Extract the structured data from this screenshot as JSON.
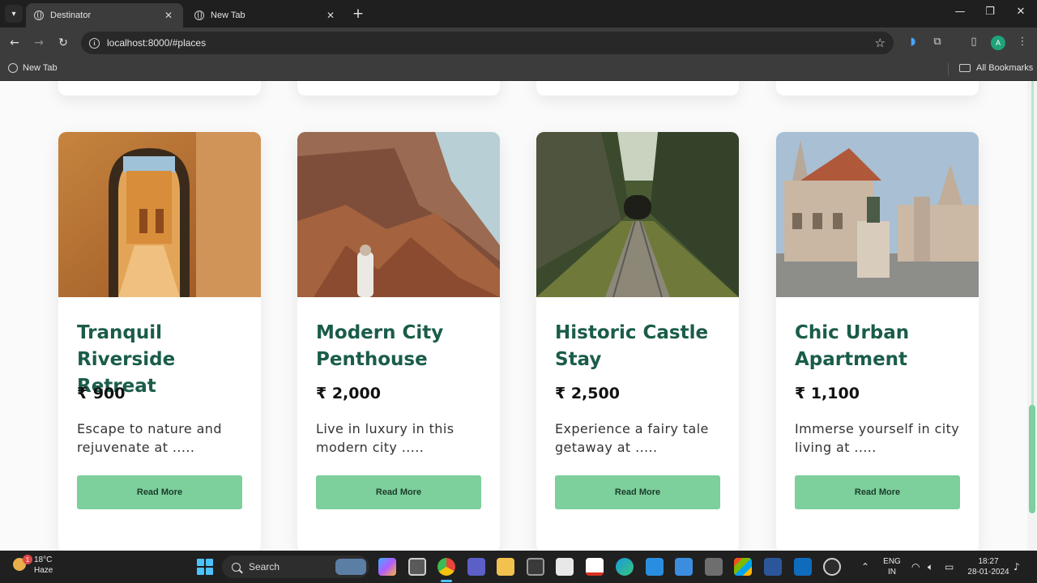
{
  "browser": {
    "tabs": [
      {
        "title": "Destinator",
        "active": true
      },
      {
        "title": "New Tab",
        "active": false
      }
    ],
    "url": "localhost:8000/#places",
    "bookmarks": [
      {
        "label": "New Tab"
      }
    ],
    "all_bookmarks_label": "All Bookmarks",
    "profile_initial": "A",
    "window_controls": {
      "minimize": "—",
      "maximize": "❐",
      "close": "✕"
    }
  },
  "places": [
    {
      "title": "Tranquil Riverside Retreat",
      "price": "₹ 900",
      "description": "Escape to nature and rejuvenate at .....",
      "button_label": "Read More",
      "image_icon": "archway-image"
    },
    {
      "title": "Modern City Penthouse",
      "price": "₹ 2,000",
      "description": "Live in luxury in this modern city .....",
      "button_label": "Read More",
      "image_icon": "canyon-image"
    },
    {
      "title": "Historic Castle Stay",
      "price": "₹ 2,500",
      "description": "Experience a fairy tale getaway at .....",
      "button_label": "Read More",
      "image_icon": "railway-tunnel-image"
    },
    {
      "title": "Chic Urban Apartment",
      "price": "₹ 1,100",
      "description": "Immerse yourself in city living at .....",
      "button_label": "Read More",
      "image_icon": "castle-image"
    }
  ],
  "taskbar": {
    "weather_temp": "18°C",
    "weather_desc": "Haze",
    "weather_badge": "1",
    "search_placeholder": "Search",
    "language_line1": "ENG",
    "language_line2": "IN",
    "time": "18:27",
    "date": "28-01-2024"
  },
  "colors": {
    "title": "#1a5c4a",
    "button": "#7dcf9b",
    "scroll_thumb": "#7dcf9f"
  }
}
